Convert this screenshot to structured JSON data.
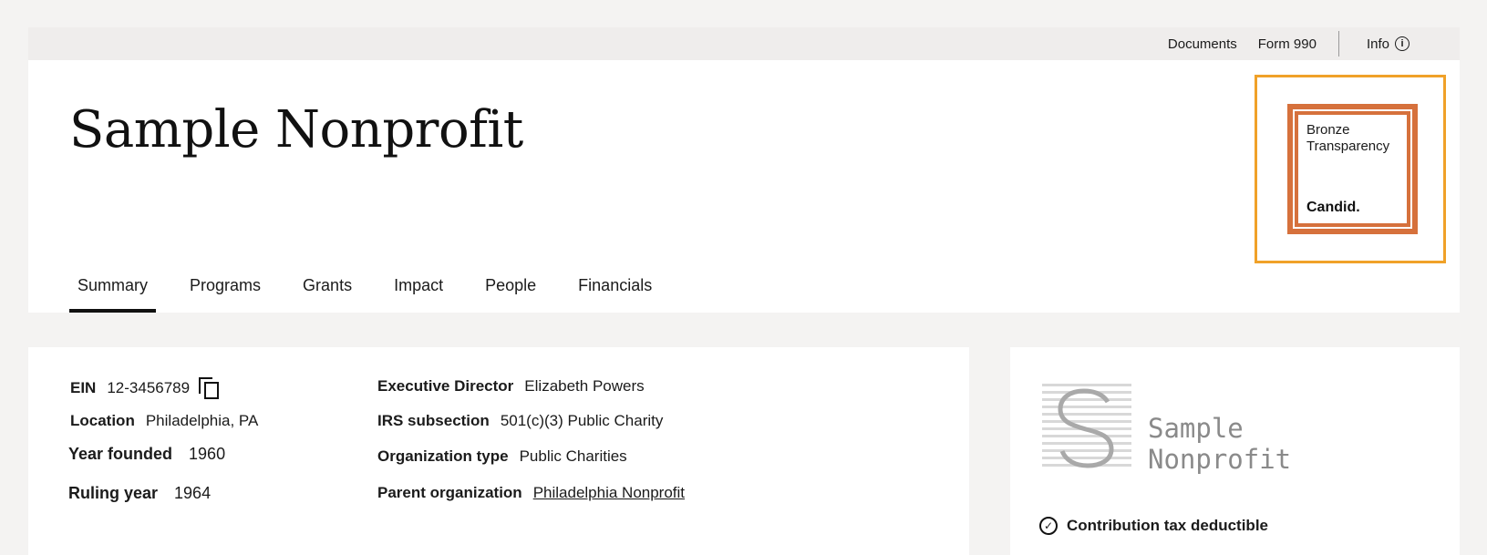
{
  "topbar": {
    "documents": "Documents",
    "form990": "Form 990",
    "info": "Info",
    "info_icon": "info-icon"
  },
  "org": {
    "name": "Sample Nonprofit"
  },
  "badge": {
    "line1": "Bronze",
    "line2": "Transparency",
    "brand": "Candid.",
    "color": "#d6713c",
    "frame_color": "#f0a128"
  },
  "tabs": [
    {
      "label": "Summary",
      "active": true
    },
    {
      "label": "Programs"
    },
    {
      "label": "Grants"
    },
    {
      "label": "Impact"
    },
    {
      "label": "People"
    },
    {
      "label": "Financials"
    }
  ],
  "facts": {
    "ein_label": "EIN",
    "ein": "12-3456789",
    "location_label": "Location",
    "location": "Philadelphia, PA",
    "founded_label": "Year founded",
    "founded": "1960",
    "ruling_label": "Ruling year",
    "ruling": "1964",
    "director_label": "Executive Director",
    "director": "Elizabeth Powers",
    "irs_label": "IRS subsection",
    "irs": "501(c)(3) Public Charity",
    "orgtype_label": "Organization type",
    "orgtype": "Public Charities",
    "parent_label": "Parent organization",
    "parent": "Philadelphia Nonprofit"
  },
  "profile": {
    "logo_name_line1": "Sample",
    "logo_name_line2": "Nonprofit",
    "deductible": "Contribution tax deductible"
  }
}
